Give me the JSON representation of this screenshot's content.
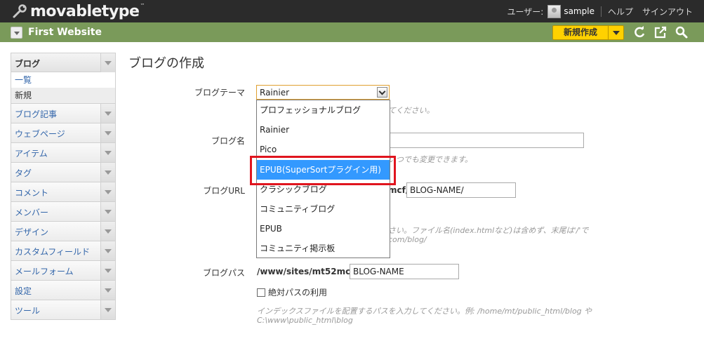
{
  "header": {
    "logo_text": "movabletype",
    "logo_tm": "™",
    "user_label": "ユーザー:",
    "username": "sample",
    "help": "ヘルプ",
    "signout": "サインアウト"
  },
  "context_bar": {
    "site_name": "First Website",
    "new_button": "新規作成"
  },
  "sidebar": {
    "section_title": "ブログ",
    "sub_items": [
      "一覧",
      "新規"
    ],
    "items": [
      "ブログ記事",
      "ウェブページ",
      "アイテム",
      "タグ",
      "コメント",
      "メンバー",
      "デザイン",
      "カスタムフィールド",
      "メールフォーム",
      "設定",
      "ツール"
    ]
  },
  "page": {
    "title": "ブログの作成"
  },
  "form": {
    "theme_label": "ブログテーマ",
    "theme_value": "Rainier",
    "theme_hint": "てください。",
    "name_label": "ブログ名",
    "name_hint": "いつでも変更できます。",
    "url_label": "ブログURL",
    "url_prefix": "mcf/",
    "url_value": "BLOG-NAME/",
    "url_hint_1": "さい。ファイル名(index.htmlなど)は含めず、末尾は'/'で",
    "url_hint_2": "com/blog/",
    "path_label": "ブログパス",
    "path_prefix": "/www/sites/mt52mcf/",
    "path_value": "BLOG-NAME",
    "absolute_path_label": "絶対パスの利用",
    "path_hint_1": "インデックスファイルを配置するパスを入力してください。例: /home/mt/public_html/blog や",
    "path_hint_2": "C:\\www\\public_html\\blog"
  },
  "dropdown": {
    "options": [
      "プロフェッショナルブログ",
      "Rainier",
      "Pico",
      "EPUB(SuperSortプラグイン用)",
      "クラシックブログ",
      "コミュニティブログ",
      "EPUB",
      "コミュニティ掲示板"
    ],
    "selected_index": 3
  },
  "colors": {
    "topbar": "#2b2b2b",
    "greenbar": "#7a9a5a",
    "new_button": "#ffd100",
    "selected_option": "#3399ff",
    "annotation_box": "#e0141e"
  }
}
